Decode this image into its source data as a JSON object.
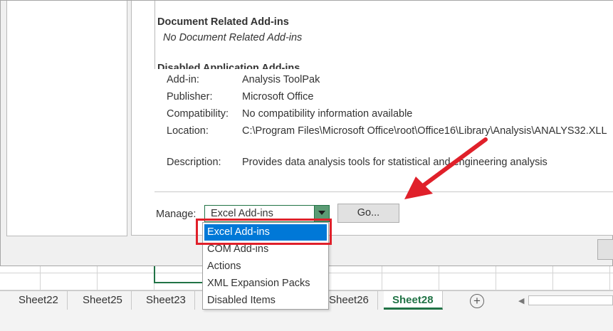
{
  "dialog": {
    "addins_list": {
      "group_document": "Document Related Add-ins",
      "group_document_empty": "No Document Related Add-ins",
      "group_disabled": "Disabled Application Add-ins"
    },
    "details": {
      "addin_label": "Add-in:",
      "addin_value": "Analysis ToolPak",
      "publisher_label": "Publisher:",
      "publisher_value": "Microsoft Office",
      "compatibility_label": "Compatibility:",
      "compatibility_value": "No compatibility information available",
      "location_label": "Location:",
      "location_value": "C:\\Program Files\\Microsoft Office\\root\\Office16\\Library\\Analysis\\ANALYS32.XLL",
      "description_label": "Description:",
      "description_value": "Provides data analysis tools for statistical and engineering analysis"
    },
    "manage": {
      "label": "Manage:",
      "selected": "Excel Add-ins",
      "go_label": "Go...",
      "options": [
        "Excel Add-ins",
        "COM Add-ins",
        "Actions",
        "XML Expansion Packs",
        "Disabled Items"
      ]
    }
  },
  "sheet_tabs": [
    "Sheet22",
    "Sheet25",
    "Sheet23",
    "Sheet26",
    "Sheet28"
  ],
  "active_sheet": "Sheet28",
  "colors": {
    "accent": "#217346",
    "selection": "#0078d7",
    "annotation": "#e0202a"
  }
}
